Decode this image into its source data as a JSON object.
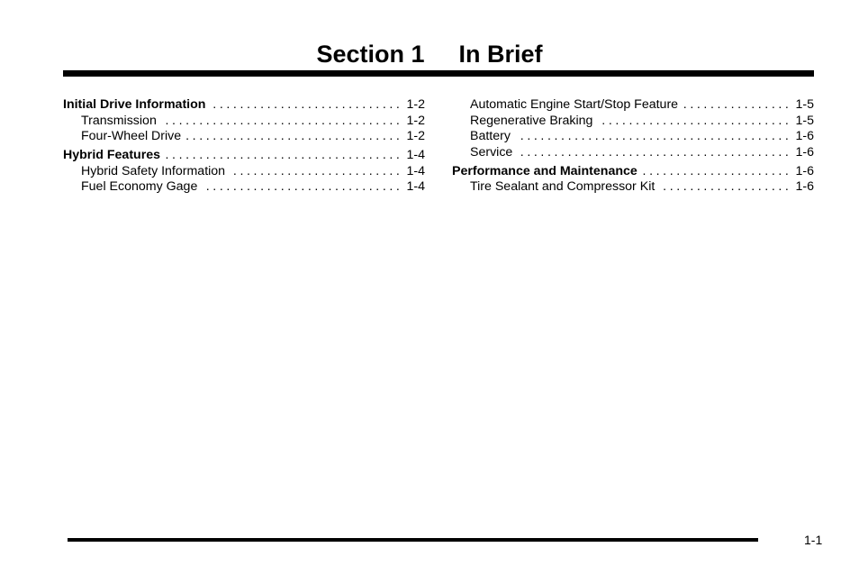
{
  "section": {
    "number_label": "Section 1",
    "title": "In Brief"
  },
  "toc": {
    "left": [
      {
        "label": "Initial Drive Information",
        "page": "1-2",
        "level": "head"
      },
      {
        "label": "Transmission",
        "page": "1-2",
        "level": "sub"
      },
      {
        "label": "Four-Wheel Drive",
        "page": "1-2",
        "level": "sub"
      },
      {
        "label": "Hybrid Features",
        "page": "1-4",
        "level": "head"
      },
      {
        "label": "Hybrid Safety Information",
        "page": "1-4",
        "level": "sub"
      },
      {
        "label": "Fuel Economy Gage",
        "page": "1-4",
        "level": "sub"
      }
    ],
    "right": [
      {
        "label": "Automatic Engine Start/Stop Feature",
        "page": "1-5",
        "level": "sub"
      },
      {
        "label": "Regenerative Braking",
        "page": "1-5",
        "level": "sub"
      },
      {
        "label": "Battery",
        "page": "1-6",
        "level": "sub"
      },
      {
        "label": "Service",
        "page": "1-6",
        "level": "sub"
      },
      {
        "label": "Performance and Maintenance",
        "page": "1-6",
        "level": "head"
      },
      {
        "label": "Tire Sealant and Compressor Kit",
        "page": "1-6",
        "level": "sub"
      }
    ],
    "leader": "...................................................................................."
  },
  "footer": {
    "page_number": "1-1"
  }
}
